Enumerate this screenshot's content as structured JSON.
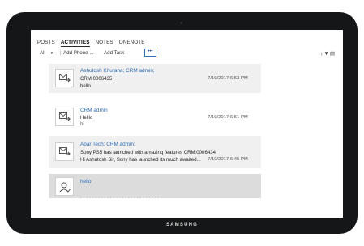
{
  "device": {
    "brand": "SAMSUNG"
  },
  "tabs": [
    {
      "label": "POSTS",
      "active": false
    },
    {
      "label": "ACTIVITIES",
      "active": true
    },
    {
      "label": "NOTES",
      "active": false
    },
    {
      "label": "ONENOTE",
      "active": false
    }
  ],
  "toolbar": {
    "filter_label": "All",
    "add_phone_label": "Add Phone ...",
    "add_task_label": "Add Task",
    "more_label": "•••"
  },
  "activities": [
    {
      "subject": "Ashutosh Khurana; CRM admin;",
      "line1": "CRM:0006435",
      "line2": "hello",
      "date": "7/19/2017 6:53 PM",
      "icon": "email-icon",
      "expandable": true
    },
    {
      "subject": "CRM admin",
      "line1": "Helllo",
      "line2": "hi",
      "date": "7/19/2017 6:51 PM",
      "icon": "email-icon",
      "expandable": false
    },
    {
      "subject": "Apar Tech; CRM admin;",
      "line1": "Sony PS5 has launched with amazing features CRM:0006434",
      "line2": "Hi Ashutosh Sir, Sony has launched its much awaited...",
      "date": "7/19/2017 6:45 PM",
      "icon": "email-icon",
      "expandable": true
    },
    {
      "subject": "hello",
      "line1": "",
      "line2": "",
      "date": "",
      "icon": "phone-call-icon",
      "expandable": false
    }
  ],
  "colors": {
    "link": "#2e6cb3",
    "selected_row": "#dcdcdc",
    "row": "#f0f0f0"
  }
}
